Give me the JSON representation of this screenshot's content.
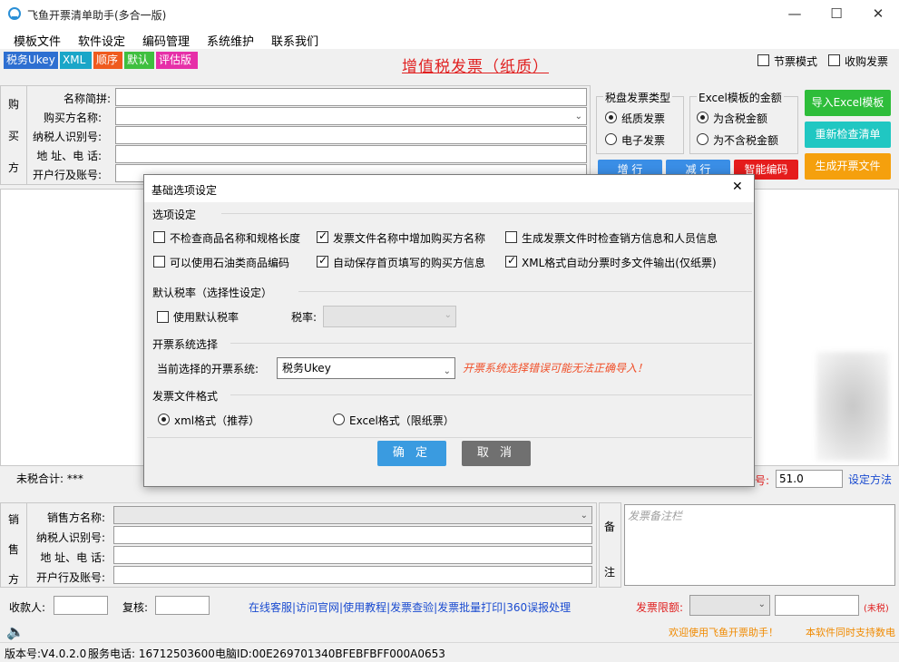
{
  "window": {
    "title": "飞鱼开票清单助手(多合一版)",
    "minimize": "—",
    "maximize": "☐",
    "close": "✕"
  },
  "menu": [
    "模板文件",
    "软件设定",
    "编码管理",
    "系统维护",
    "联系我们"
  ],
  "badges": [
    {
      "label": "税务Ukey",
      "color": "#2d6fd1"
    },
    {
      "label": "XML",
      "color": "#1aa6c8"
    },
    {
      "label": "顺序",
      "color": "#ef5a1e"
    },
    {
      "label": "默认",
      "color": "#3fbf3f"
    },
    {
      "label": "评估版",
      "color": "#e62fa8"
    }
  ],
  "invoice_title": "增值税发票（纸质）",
  "top_checks": {
    "festival_mode": {
      "label": "节票模式",
      "checked": false
    },
    "purchase_invoice": {
      "label": "收购发票",
      "checked": false
    }
  },
  "buyer": {
    "side_label": [
      "购",
      "买",
      "方"
    ],
    "fields": [
      {
        "label": "名称简拼:",
        "value": ""
      },
      {
        "label": "购买方名称:",
        "value": ""
      },
      {
        "label": "纳税人识别号:",
        "value": ""
      },
      {
        "label": "地 址、电 话:",
        "value": ""
      },
      {
        "label": "开户行及账号:",
        "value": ""
      }
    ]
  },
  "disk_type": {
    "title": "税盘发票类型",
    "options": [
      {
        "label": "纸质发票",
        "selected": true
      },
      {
        "label": "电子发票",
        "selected": false
      }
    ]
  },
  "excel_amount": {
    "title": "Excel模板的金额",
    "options": [
      {
        "label": "为含税金额",
        "selected": true
      },
      {
        "label": "为不含税金额",
        "selected": false
      }
    ]
  },
  "action_buttons": {
    "import_excel": {
      "label": "导入Excel模板",
      "color": "#2ebd3a"
    },
    "recheck": {
      "label": "重新检查清单",
      "color": "#20c7c2"
    },
    "generate": {
      "label": "生成开票文件",
      "color": "#f5a00d"
    },
    "add_row": {
      "label": "增 行",
      "color": "#3a8ee6"
    },
    "del_row": {
      "label": "减 行",
      "color": "#3a8ee6"
    },
    "smart_code": {
      "label": "智能编码",
      "color": "#e51c1c"
    }
  },
  "totals": {
    "untaxed_label": "未税合计: ***",
    "no_label": "号:",
    "no_value": "51.0",
    "set_method": "设定方法"
  },
  "dialog": {
    "title": "基础选项设定",
    "close": "✕",
    "options_section": "选项设定",
    "options": [
      {
        "label": "不检查商品名称和规格长度",
        "checked": false
      },
      {
        "label": "发票文件名称中增加购买方名称",
        "checked": true
      },
      {
        "label": "生成发票文件时检查销方信息和人员信息",
        "checked": false
      },
      {
        "label": "可以使用石油类商品编码",
        "checked": false
      },
      {
        "label": "自动保存首页填写的购买方信息",
        "checked": true
      },
      {
        "label": "XML格式自动分票时多文件输出(仅纸票)",
        "checked": true
      }
    ],
    "tax_section": "默认税率（选择性设定）",
    "use_default_rate": {
      "label": "使用默认税率",
      "checked": false
    },
    "rate_label": "税率:",
    "rate_value": "",
    "system_section": "开票系统选择",
    "current_system_label": "当前选择的开票系统:",
    "current_system_value": "税务Ukey",
    "warning": "开票系统选择错误可能无法正确导入！",
    "format_section": "发票文件格式",
    "formats": [
      {
        "label": "xml格式（推荐）",
        "selected": true
      },
      {
        "label": "Excel格式（限纸票）",
        "selected": false
      }
    ],
    "ok": "确 定",
    "cancel": "取 消",
    "ok_color": "#3a9be0",
    "cancel_color": "#707070"
  },
  "seller": {
    "side_label": [
      "销",
      "售",
      "方"
    ],
    "fields": [
      {
        "label": "销售方名称:",
        "value": ""
      },
      {
        "label": "纳税人识别号:",
        "value": ""
      },
      {
        "label": "地 址、电 话:",
        "value": ""
      },
      {
        "label": "开户行及账号:",
        "value": ""
      }
    ],
    "remark_side": [
      "备",
      "注"
    ],
    "remark_placeholder": "发票备注栏"
  },
  "bottom": {
    "payee_label": "收款人:",
    "review_label": "复核:",
    "links": "在线客服|访问官网|使用教程|发票查验|发票批量打印|360误报处理",
    "limit_label": "发票限额:",
    "untaxed_hint": "(未税)",
    "welcome": "欢迎使用飞鱼开票助手！",
    "support": "本软件同时支持数电"
  },
  "status": {
    "version": "版本号:V4.0.2.0",
    "phone": "服务电话: 16712503600",
    "pc_id": "电脑ID:00E269701340BFEBFBFF000A0653"
  }
}
